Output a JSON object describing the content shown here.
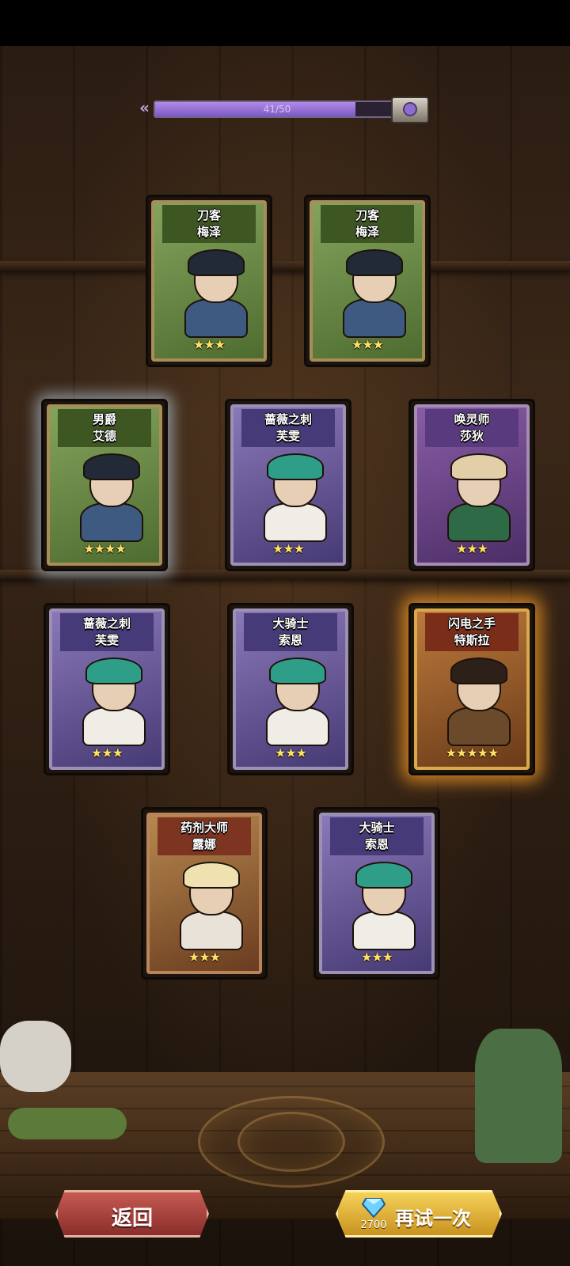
{
  "progress": {
    "text": "41/50",
    "current": 41,
    "max": 50
  },
  "cards": [
    {
      "class": "刀客",
      "name": "梅泽",
      "stars": "★★★",
      "theme": "green",
      "glow": "none"
    },
    {
      "class": "刀客",
      "name": "梅泽",
      "stars": "★★★",
      "theme": "green",
      "glow": "none"
    },
    {
      "class": "男爵",
      "name": "艾德",
      "stars": "★★★★",
      "theme": "green",
      "glow": "white"
    },
    {
      "class": "蔷薇之刺",
      "name": "芙雯",
      "stars": "★★★",
      "theme": "purple",
      "glow": "none"
    },
    {
      "class": "唤灵师",
      "name": "莎狄",
      "stars": "★★★",
      "theme": "violet",
      "glow": "none"
    },
    {
      "class": "蔷薇之刺",
      "name": "芙雯",
      "stars": "★★★",
      "theme": "purple",
      "glow": "none"
    },
    {
      "class": "大骑士",
      "name": "索恩",
      "stars": "★★★",
      "theme": "purple",
      "glow": "none"
    },
    {
      "class": "闪电之手",
      "name": "特斯拉",
      "stars": "★★★★★",
      "theme": "gold",
      "glow": "gold"
    },
    {
      "class": "药剂大师",
      "name": "露娜",
      "stars": "★★★",
      "theme": "red",
      "glow": "none"
    },
    {
      "class": "大骑士",
      "name": "索恩",
      "stars": "★★★",
      "theme": "purple",
      "glow": "none"
    }
  ],
  "buttons": {
    "back_label": "返回",
    "retry_label": "再试一次",
    "retry_cost": "2700",
    "retry_cost_icon": "diamond-icon"
  },
  "icons": {
    "progress_chest": "chest-icon",
    "progress_arrows": "double-chevron-left-icon"
  }
}
